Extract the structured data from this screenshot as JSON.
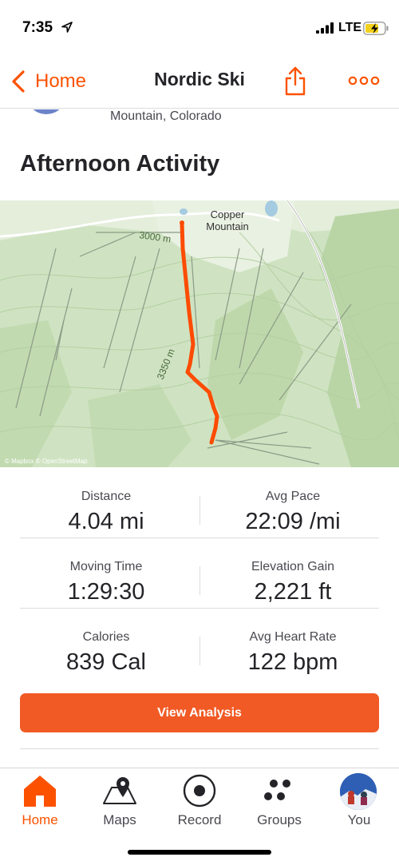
{
  "status_bar": {
    "time": "7:35",
    "network": "LTE",
    "icons": [
      "location-arrow-icon",
      "signal-icon",
      "battery-charging-icon"
    ]
  },
  "nav": {
    "back_label": "Home",
    "title": "Nordic Ski",
    "icons": [
      "chevron-left-icon",
      "share-icon",
      "more-icon"
    ],
    "accent_color": "#fc5200"
  },
  "activity": {
    "location": "Mountain, Colorado",
    "title": "Afternoon Activity"
  },
  "map": {
    "place_label_line1": "Copper",
    "place_label_line2": "Mountain",
    "contour_label_1": "3000 m",
    "contour_label_2": "3350 m",
    "attribution": "© Mapbox  © OpenStreetMap",
    "route_color": "#fc4c02",
    "terrain_color": "#cfe3c2"
  },
  "stats": [
    {
      "left": {
        "label": "Distance",
        "value": "4.04 mi"
      },
      "right": {
        "label": "Avg Pace",
        "value": "22:09 /mi"
      }
    },
    {
      "left": {
        "label": "Moving Time",
        "value": "1:29:30"
      },
      "right": {
        "label": "Elevation Gain",
        "value": "2,221 ft"
      }
    },
    {
      "left": {
        "label": "Calories",
        "value": "839 Cal"
      },
      "right": {
        "label": "Avg Heart Rate",
        "value": "122 bpm"
      }
    }
  ],
  "analysis_button": {
    "label": "View Analysis",
    "color": "#f15a24"
  },
  "tab_bar": {
    "tabs": [
      {
        "label": "Home",
        "icon": "home-icon",
        "active": true
      },
      {
        "label": "Maps",
        "icon": "map-icon",
        "active": false
      },
      {
        "label": "Record",
        "icon": "record-icon",
        "active": false
      },
      {
        "label": "Groups",
        "icon": "groups-icon",
        "active": false
      },
      {
        "label": "You",
        "icon": "profile-avatar",
        "active": false
      }
    ]
  }
}
